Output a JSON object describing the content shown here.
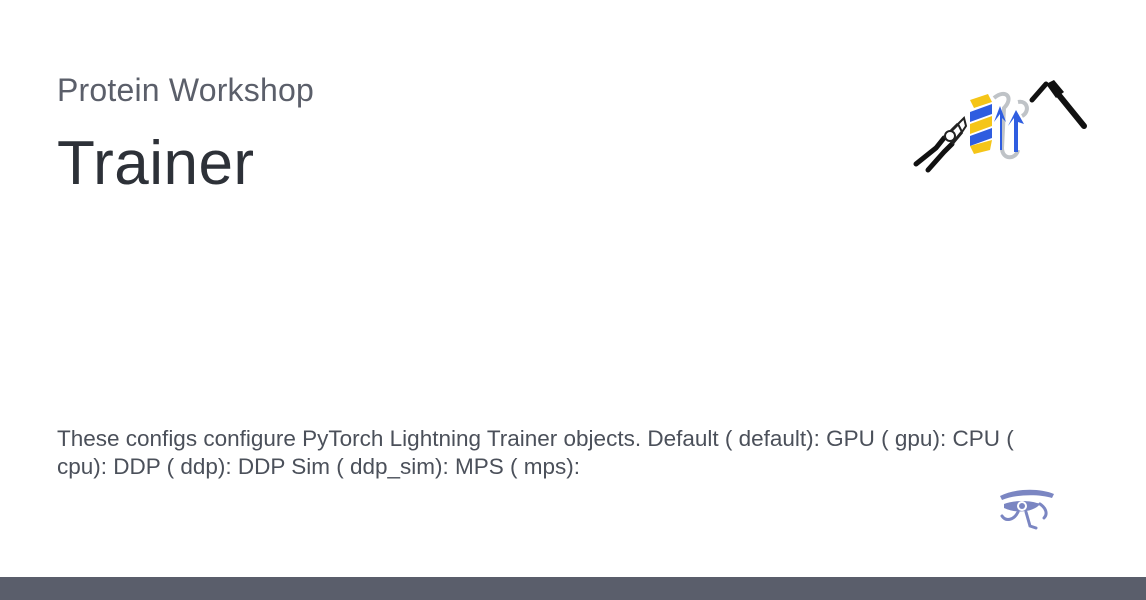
{
  "header": {
    "site_name": "Protein Workshop",
    "page_title": "Trainer"
  },
  "main": {
    "description": "These configs configure PyTorch Lightning Trainer objects. Default ( default): GPU ( gpu): CPU ( cpu): DDP ( ddp): DDP Sim ( ddp_sim): MPS ( mps):"
  },
  "icons": {
    "logo": "protein-workshop-logo-icon",
    "pliers": "pliers-icon",
    "protein": "protein-structure-icon",
    "hammer": "hammer-icon",
    "material": "material-eye-icon"
  },
  "colors": {
    "title": "#2d3138",
    "subtitle": "#5b5f6a",
    "text": "#4b505a",
    "footer": "#5a5e6b",
    "protein_yellow": "#f5c518",
    "protein_blue": "#2f5de0",
    "material_icon": "#7b86c2"
  }
}
